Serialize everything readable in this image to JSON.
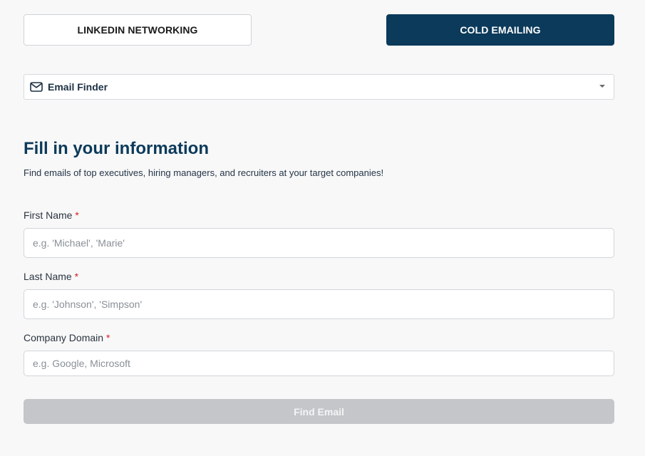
{
  "tabs": {
    "linkedin_label": "LINKEDIN NETWORKING",
    "cold_label": "COLD EMAILING",
    "active": "cold_emailing"
  },
  "tool_select": {
    "icon": "mail-icon",
    "value": "Email Finder"
  },
  "form": {
    "title": "Fill in your information",
    "subtitle": "Find emails of top executives, hiring managers, and recruiters at your target companies!",
    "required_marker": "*",
    "first_name": {
      "label": "First Name",
      "value": "",
      "placeholder": "e.g. 'Michael', 'Marie'"
    },
    "last_name": {
      "label": "Last Name",
      "value": "",
      "placeholder": "e.g. 'Johnson', 'Simpson'"
    },
    "company_domain": {
      "label": "Company Domain",
      "value": "",
      "placeholder": "e.g. Google, Microsoft"
    },
    "submit_label": "Find Email",
    "submit_enabled": false
  },
  "colors": {
    "primary": "#0b3a5b",
    "background": "#f8f8f8",
    "required": "#d62020",
    "disabled_button": "#c4c6c9"
  }
}
